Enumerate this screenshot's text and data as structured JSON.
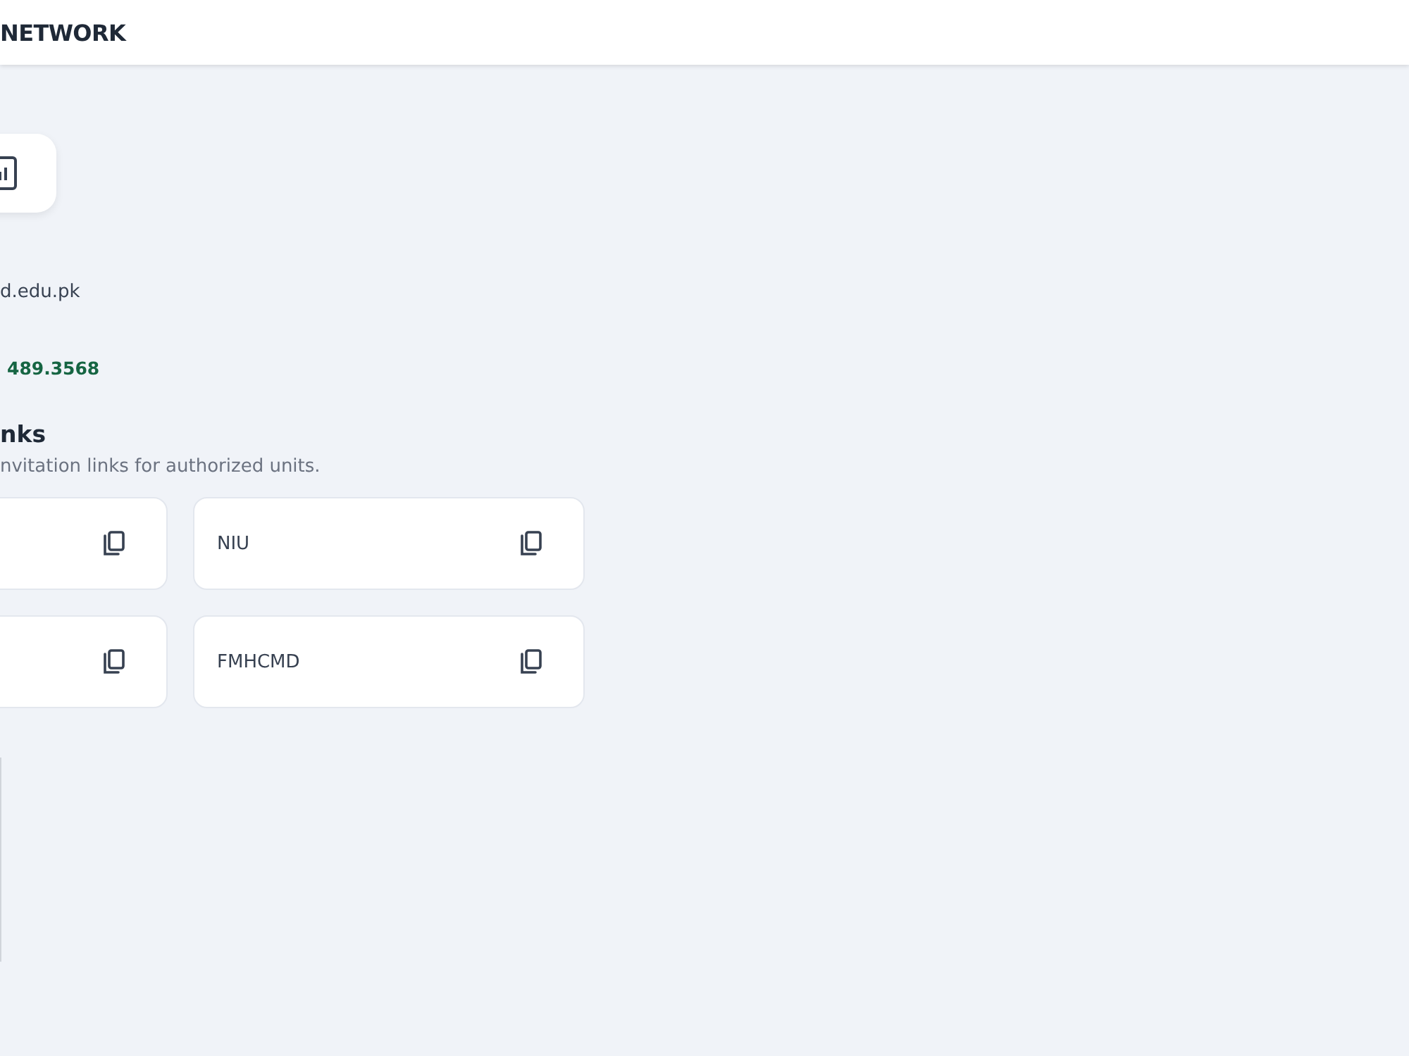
{
  "header": {
    "title": "NETWORK"
  },
  "contact": {
    "email": "d.edu.pk",
    "phone": "489.3568"
  },
  "links_section": {
    "heading": "nks",
    "description": "nvitation links for authorized units.",
    "links": [
      {
        "kind": "partial"
      },
      {
        "kind": "full",
        "label": "NIU"
      },
      {
        "kind": "partial"
      },
      {
        "kind": "full",
        "label": "FMHCMD"
      }
    ]
  }
}
